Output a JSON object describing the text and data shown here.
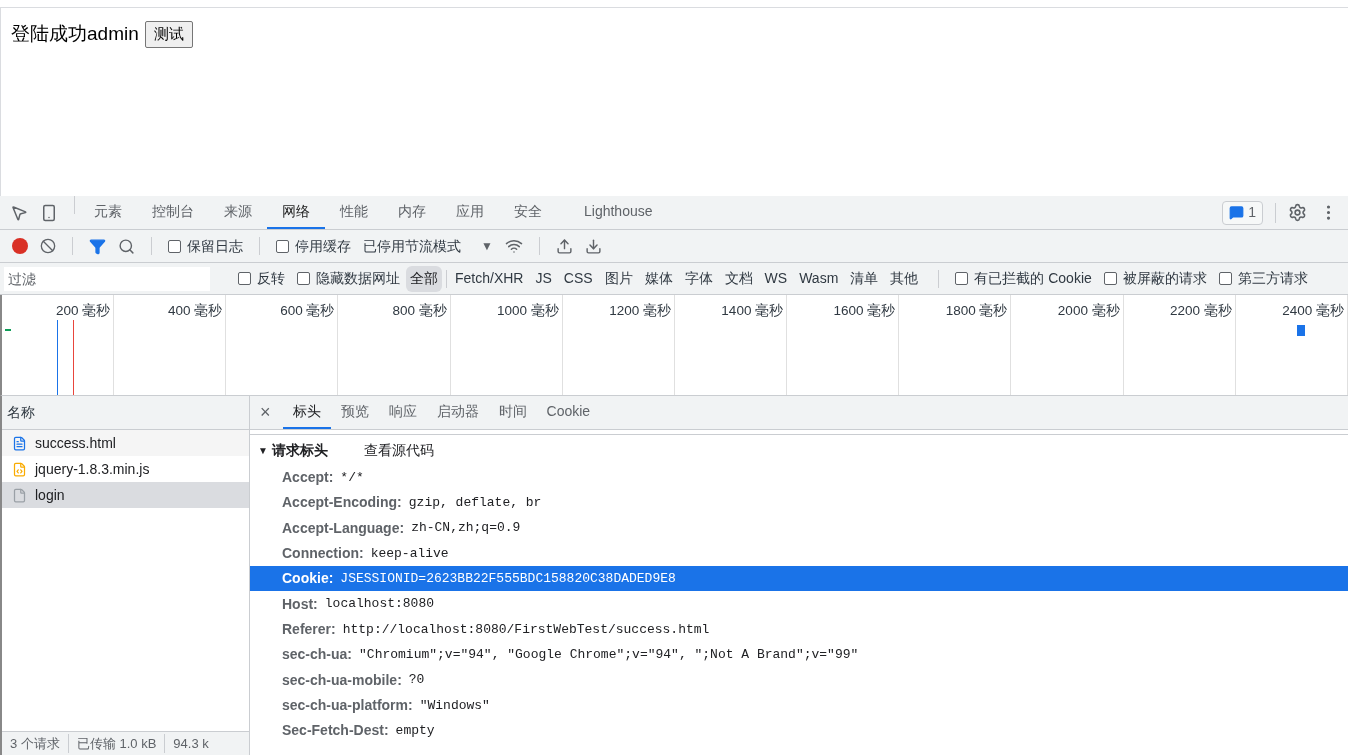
{
  "page": {
    "message": "登陆成功admin",
    "button": "测试"
  },
  "devtools": {
    "tabs": [
      {
        "label": "元素",
        "selected": false
      },
      {
        "label": "控制台",
        "selected": false
      },
      {
        "label": "来源",
        "selected": false
      },
      {
        "label": "网络",
        "selected": true
      },
      {
        "label": "性能",
        "selected": false
      },
      {
        "label": "内存",
        "selected": false
      },
      {
        "label": "应用",
        "selected": false
      },
      {
        "label": "安全",
        "selected": false
      },
      {
        "label": "Lighthouse",
        "selected": false
      }
    ],
    "issues_count": "1",
    "toolbar": {
      "preserve_log": {
        "label": "保留日志",
        "checked": false
      },
      "disable_cache": {
        "label": "停用缓存",
        "checked": false
      },
      "throttling": "已停用节流模式",
      "dropdown_arrow": "▼"
    },
    "filter": {
      "placeholder": "过滤",
      "invert": {
        "label": "反转",
        "checked": false
      },
      "hide_data_urls": {
        "label": "隐藏数据网址",
        "checked": false
      },
      "types": [
        {
          "label": "全部",
          "selected": true
        },
        {
          "label": "Fetch/XHR",
          "selected": false
        },
        {
          "label": "JS",
          "selected": false
        },
        {
          "label": "CSS",
          "selected": false
        },
        {
          "label": "图片",
          "selected": false
        },
        {
          "label": "媒体",
          "selected": false
        },
        {
          "label": "字体",
          "selected": false
        },
        {
          "label": "文档",
          "selected": false
        },
        {
          "label": "WS",
          "selected": false
        },
        {
          "label": "Wasm",
          "selected": false
        },
        {
          "label": "清单",
          "selected": false
        },
        {
          "label": "其他",
          "selected": false
        }
      ],
      "options": [
        {
          "label": "有已拦截的 Cookie",
          "checked": false
        },
        {
          "label": "被屏蔽的请求",
          "checked": false
        },
        {
          "label": "第三方请求",
          "checked": false
        }
      ]
    },
    "timeline": {
      "ticks": [
        "200 毫秒",
        "400 毫秒",
        "600 毫秒",
        "800 毫秒",
        "1000 毫秒",
        "1200 毫秒",
        "1400 毫秒",
        "1600 毫秒",
        "1800 毫秒",
        "2000 毫秒",
        "2200 毫秒",
        "2400 毫秒"
      ]
    },
    "requests": {
      "column": "名称",
      "items": [
        {
          "name": "success.html",
          "kind": "document",
          "selected": false
        },
        {
          "name": "jquery-1.8.3.min.js",
          "kind": "script",
          "selected": false
        },
        {
          "name": "login",
          "kind": "other",
          "selected": true
        }
      ]
    },
    "status_bar": [
      "3 个请求",
      "已传输 1.0 kB",
      "94.3 k"
    ],
    "detail": {
      "close": "×",
      "tabs": [
        {
          "label": "标头",
          "selected": true
        },
        {
          "label": "预览",
          "selected": false
        },
        {
          "label": "响应",
          "selected": false
        },
        {
          "label": "启动器",
          "selected": false
        },
        {
          "label": "时间",
          "selected": false
        },
        {
          "label": "Cookie",
          "selected": false
        }
      ],
      "section": {
        "title": "请求标头",
        "expanded": true,
        "toggle": "▼",
        "view_source": "查看源代码"
      },
      "headers": [
        {
          "name": "Accept:",
          "value": "*/*",
          "selected": false
        },
        {
          "name": "Accept-Encoding:",
          "value": "gzip, deflate, br",
          "selected": false
        },
        {
          "name": "Accept-Language:",
          "value": "zh-CN,zh;q=0.9",
          "selected": false
        },
        {
          "name": "Connection:",
          "value": "keep-alive",
          "selected": false
        },
        {
          "name": "Cookie:",
          "value": "JSESSIONID=2623BB22F555BDC158820C38DADED9E8",
          "selected": true
        },
        {
          "name": "Host:",
          "value": "localhost:8080",
          "selected": false
        },
        {
          "name": "Referer:",
          "value": "http://localhost:8080/FirstWebTest/success.html",
          "selected": false
        },
        {
          "name": "sec-ch-ua:",
          "value": "\"Chromium\";v=\"94\", \"Google Chrome\";v=\"94\", \";Not A Brand\";v=\"99\"",
          "selected": false
        },
        {
          "name": "sec-ch-ua-mobile:",
          "value": "?0",
          "selected": false
        },
        {
          "name": "sec-ch-ua-platform:",
          "value": "\"Windows\"",
          "selected": false
        },
        {
          "name": "Sec-Fetch-Dest:",
          "value": "empty",
          "selected": false
        }
      ]
    }
  }
}
